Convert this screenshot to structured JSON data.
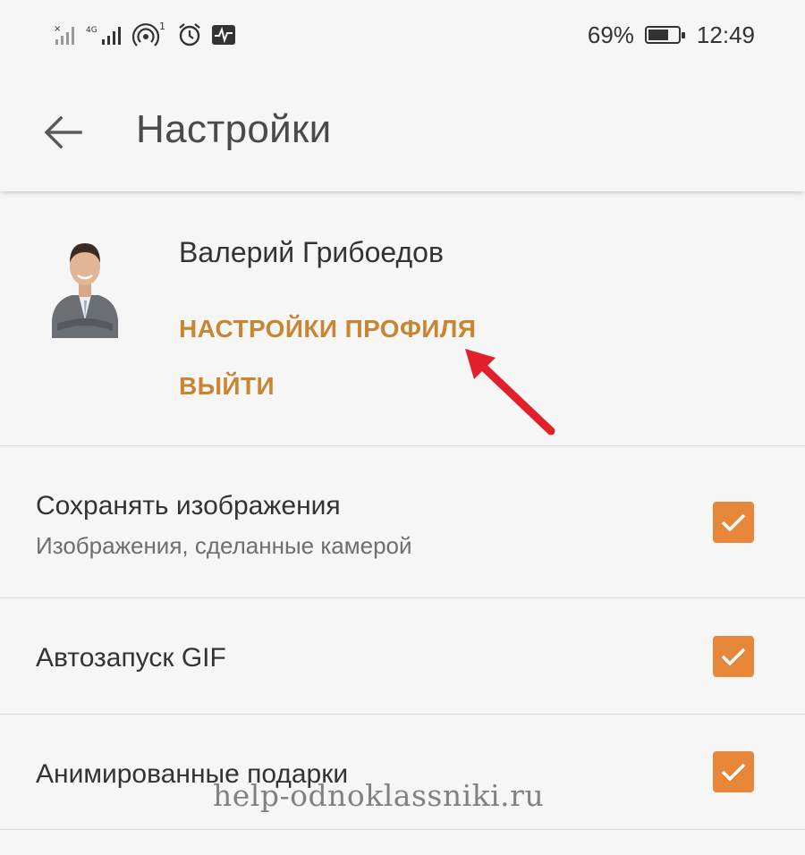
{
  "status_bar": {
    "battery_percent": "69%",
    "battery_level": 0.69,
    "time": "12:49",
    "network_label": "4G",
    "notification_count": "1",
    "icons": [
      "no-signal-icon",
      "signal-4g-icon",
      "hotspot-icon",
      "alarm-icon",
      "activity-icon",
      "battery-icon"
    ]
  },
  "header": {
    "title": "Настройки",
    "back_icon": "back-arrow-icon"
  },
  "profile": {
    "name": "Валерий Грибоедов",
    "profile_settings_label": "НАСТРОЙКИ ПРОФИЛЯ",
    "logout_label": "ВЫЙТИ"
  },
  "settings": {
    "save_images": {
      "title": "Сохранять изображения",
      "subtitle": "Изображения, сделанные камерой",
      "checked": true
    },
    "autoplay_gif": {
      "title": "Автозапуск GIF",
      "checked": true
    },
    "animated_gifts": {
      "title": "Анимированные подарки",
      "checked": true
    }
  },
  "watermark": "help-odnoklassniki.ru",
  "colors": {
    "accent": "#c98632",
    "checkbox": "#e8863a",
    "annotation_arrow": "#e0202a"
  }
}
